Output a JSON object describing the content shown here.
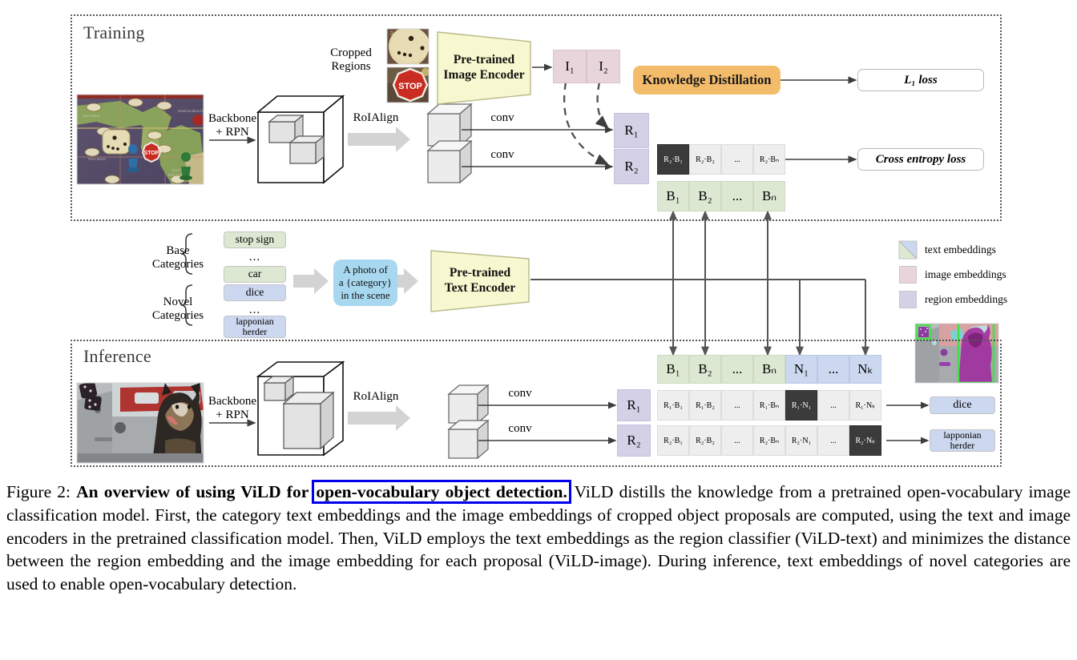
{
  "figure": {
    "sections": {
      "training": "Training",
      "inference": "Inference"
    },
    "training": {
      "backbone_label_line1": "Backbone",
      "backbone_label_line2": "+ RPN",
      "cropped_regions_line1": "Cropped",
      "cropped_regions_line2": "Regions",
      "roialign": "RoIAlign",
      "conv1": "conv",
      "conv2": "conv",
      "image_encoder_line1": "Pre-trained",
      "image_encoder_line2": "Image Encoder",
      "image_embeddings": [
        "I₁",
        "I₂"
      ],
      "region_embeddings": [
        "R₁",
        "R₂"
      ],
      "knowledge_distillation": "Knowledge Distillation",
      "l1_loss": "L₁ loss",
      "cross_entropy_loss": "Cross entropy loss",
      "similarity_row": [
        "R₂·B₁",
        "R₂·B₂",
        "...",
        "R₂·Bₙ"
      ],
      "base_embedding_row": [
        "B₁",
        "B₂",
        "...",
        "Bₙ"
      ]
    },
    "categories": {
      "base_label_line1": "Base",
      "base_label_line2": "Categories",
      "novel_label_line1": "Novel",
      "novel_label_line2": "Categories",
      "base_items": [
        "stop sign",
        "...",
        "car"
      ],
      "novel_items": [
        "dice",
        "...",
        "lapponian\nherder"
      ],
      "prompt_line1": "A photo of",
      "prompt_line2": "a {category}",
      "prompt_line3": "in the scene",
      "text_encoder_line1": "Pre-trained",
      "text_encoder_line2": "Text Encoder"
    },
    "legend": [
      {
        "name": "text embeddings",
        "swatch": "split-green-blue"
      },
      {
        "name": "image embeddings",
        "swatch": "pink"
      },
      {
        "name": "region embeddings",
        "swatch": "purple"
      }
    ],
    "inference": {
      "backbone_label_line1": "Backbone",
      "backbone_label_line2": "+ RPN",
      "roialign": "RoIAlign",
      "conv1": "conv",
      "conv2": "conv",
      "region_embeddings": [
        "R₁",
        "R₂"
      ],
      "embedding_row": [
        "B₁",
        "B₂",
        "...",
        "Bₙ",
        "N₁",
        "...",
        "Nₖ"
      ],
      "embedding_row_kind": [
        "base",
        "base",
        "base",
        "base",
        "novel",
        "novel",
        "novel"
      ],
      "sim_row_1": [
        "R₁·B₁",
        "R₁·B₂",
        "...",
        "R₁·Bₙ",
        "R₁·N₁",
        "...",
        "R₁·Nₖ"
      ],
      "sim_row_1_highlight": 4,
      "sim_row_2": [
        "R₂·B₁",
        "R₂·B₂",
        "...",
        "R₂·Bₙ",
        "R₂·N₁",
        "...",
        "R₂·Nₖ"
      ],
      "sim_row_2_highlight": 6,
      "output_1": "dice",
      "output_2": "lapponian\nherder"
    },
    "colors": {
      "base_green": "#dde8d3",
      "novel_blue": "#ccd8f0",
      "region_purple": "#d4d0e6",
      "image_pink": "#e8d4db",
      "knowledge_distillation_orange": "#f3bc6a",
      "prompt_blue": "#a8d8f0",
      "encoder_yellow": "#f8f8d0",
      "highlight_dark": "#3b3b3b",
      "caption_highlight_outline": "#0000ee",
      "detection_box_green": "#44e048"
    }
  },
  "caption": {
    "prefix": "Figure 2:",
    "bold_before": "An overview of using ViLD for",
    "bold_highlight": "open-vocabulary object detection.",
    "body": " ViLD distills the knowledge from a pretrained open-vocabulary image classification model. First, the category text embeddings and the image embeddings of cropped object proposals are computed, using the text and image encoders in the pretrained classification model.  Then, ViLD employs the text embeddings as the region classifier (ViLD-text) and minimizes the distance between the region embedding and the image embedding for each proposal (ViLD-image). During inference, text embeddings of novel categories are used to enable open-vocabulary detection."
  }
}
